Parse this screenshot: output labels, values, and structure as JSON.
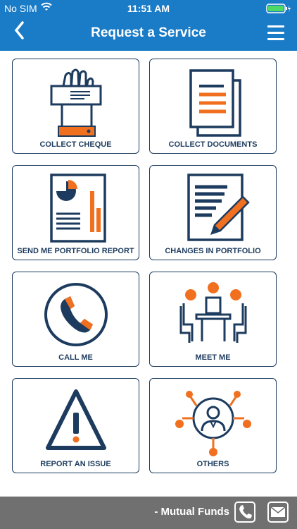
{
  "status": {
    "carrier": "No SIM",
    "time": "11:51 AM"
  },
  "nav": {
    "title": "Request a Service",
    "back_icon": "chevron-left-icon",
    "menu_icon": "hamburger-menu-icon"
  },
  "colors": {
    "brand_blue": "#1a7bc6",
    "navy": "#1d3b5e",
    "orange": "#f07020",
    "footer_gray": "#707070"
  },
  "tiles": [
    {
      "label": "COLLECT CHEQUE",
      "icon": "hand-cheque-icon"
    },
    {
      "label": "COLLECT DOCUMENTS",
      "icon": "documents-icon"
    },
    {
      "label": "SEND ME PORTFOLIO REPORT",
      "icon": "report-chart-icon"
    },
    {
      "label": "CHANGES IN PORTFOLIO",
      "icon": "edit-document-icon"
    },
    {
      "label": "CALL ME",
      "icon": "phone-icon"
    },
    {
      "label": "MEET ME",
      "icon": "meeting-icon"
    },
    {
      "label": "REPORT AN ISSUE",
      "icon": "warning-icon"
    },
    {
      "label": "OTHERS",
      "icon": "network-user-icon"
    }
  ],
  "footer": {
    "marquee": "- Mutual Funds",
    "phone_icon": "phone-icon",
    "mail_icon": "mail-icon"
  }
}
